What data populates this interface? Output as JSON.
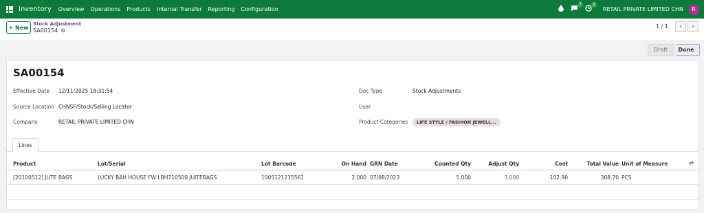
{
  "nav": {
    "app_name": "Inventory",
    "menu": [
      "Overview",
      "Operations",
      "Products",
      "Internal Transfer",
      "Reporting",
      "Configuration"
    ],
    "chat_badge": "7",
    "activity_badge": "2",
    "company": "RETAIL PRIVATE LIMITED CHN",
    "avatar_letter": "R"
  },
  "control": {
    "new_label": "+ New",
    "breadcrumb_parent": "Stock Adjustment",
    "breadcrumb_current": "SA00154",
    "pager": "1 / 1"
  },
  "status": {
    "stages": [
      "Draft",
      "Done"
    ],
    "current": "Done"
  },
  "record": {
    "title": "SA00154",
    "effective_date_label": "Effective Date",
    "effective_date": "12/11/2025 18:31:54",
    "source_location_label": "Source Location",
    "source_location": "CHNSF/Stock/Selling Locator",
    "company_label": "Company",
    "company": "RETAIL PRIVATE LIMITED CHN",
    "doc_type_label": "Doc Type",
    "doc_type": "Stock Adjustments",
    "user_label": "User",
    "user": "",
    "product_categories_label": "Product Categories",
    "product_category_tag": "LIFE STYLE / FASHION JEWELL..."
  },
  "tabs": [
    "Lines"
  ],
  "table": {
    "columns": [
      "Product",
      "Lot/Serial",
      "Lot Barcode",
      "On Hand",
      "GRN Date",
      "Counted Qty",
      "Adjust Qty",
      "Cost",
      "Total Value",
      "Unit of Measure"
    ],
    "rows": [
      [
        "[20100512] JUTE BAGS",
        "LUCKY BAH HOUSE FW LBH710500 JUITEBAGS",
        "1005121235561",
        "2.000",
        "07/08/2023",
        "5.000",
        "3.000",
        "102.90",
        "308.70",
        "PCS"
      ]
    ]
  },
  "colors": {
    "nav_bg": "#0b7a3b",
    "accent_purple": "#6a4c78",
    "adjust_qty": "#1e7d32",
    "avatar_bg": "#b2338b"
  },
  "icons": [
    "apps-grid-icon",
    "drop-icon",
    "chat-icon",
    "activity-icon",
    "gear-icon",
    "chevron-left-icon",
    "chevron-right-icon",
    "column-settings-icon"
  ]
}
